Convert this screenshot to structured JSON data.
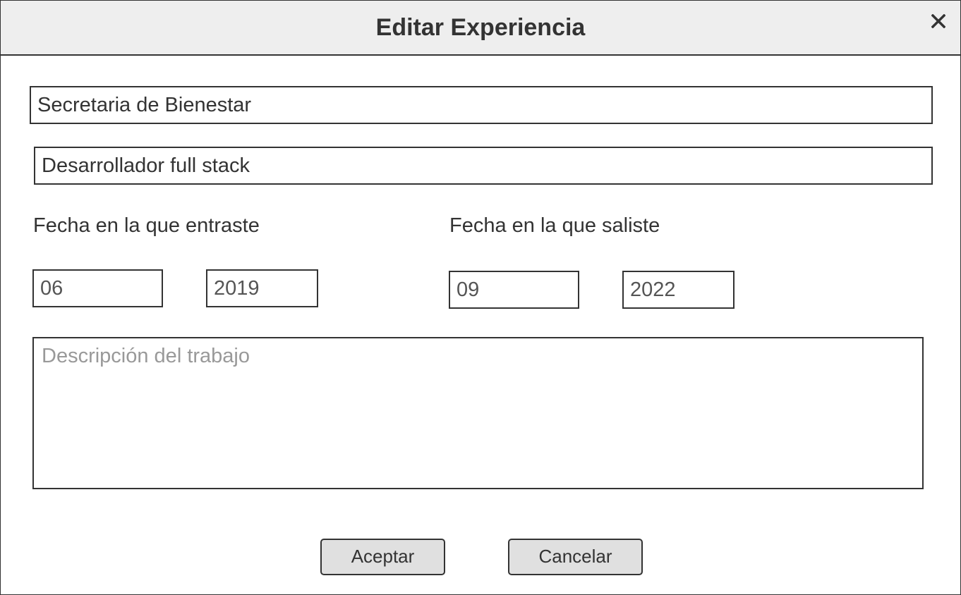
{
  "dialog": {
    "title": "Editar Experiencia",
    "close_icon": "close-icon"
  },
  "form": {
    "company": {
      "value": "Secretaria de Bienestar",
      "placeholder": ""
    },
    "position": {
      "value": "Desarrollador full stack",
      "placeholder": ""
    },
    "start_date": {
      "label": "Fecha en la que entraste",
      "month": "06",
      "year": "2019"
    },
    "end_date": {
      "label": "Fecha en la que saliste",
      "month": "09",
      "year": "2022"
    },
    "description": {
      "value": "",
      "placeholder": "Descripción del trabajo"
    }
  },
  "actions": {
    "accept_label": "Aceptar",
    "cancel_label": "Cancelar"
  },
  "colors": {
    "header_bg": "#eeeeee",
    "border": "#333333",
    "button_bg": "#e0e0e0",
    "placeholder": "#999999"
  }
}
